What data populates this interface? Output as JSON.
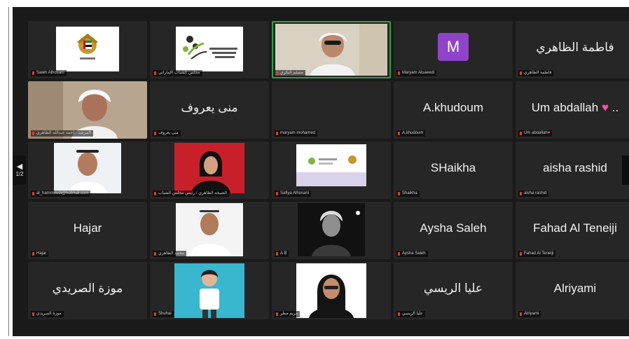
{
  "pagination": {
    "prev_icon": "◀",
    "prev_label": "1/2"
  },
  "tiles": [
    {
      "display": "",
      "tag": "Saleh Alhosani",
      "kind": "emblem"
    },
    {
      "display": "",
      "tag": "مجلس الشباب الإماراتي",
      "kind": "logo"
    },
    {
      "display": "",
      "tag": "مسلم البكري",
      "kind": "video",
      "active": true
    },
    {
      "display": "M",
      "tag": "Maryam Alsaeedi",
      "kind": "avatar"
    },
    {
      "display": "فاطمة الظاهري",
      "tag": "فاطمة الظاهري",
      "kind": "name"
    },
    {
      "display": "",
      "tag": "المرشد - أحمد عبدالله الظاهري",
      "kind": "video"
    },
    {
      "display": "منى يعروف",
      "tag": "منى يعروف",
      "kind": "name"
    },
    {
      "display": "",
      "tag": "maryam mohamed",
      "kind": "blank"
    },
    {
      "display": "A.khudoum",
      "tag": "A.khudoum",
      "kind": "name"
    },
    {
      "display": "Um abdallah",
      "tag": "Um abdallah",
      "kind": "name-heart"
    },
    {
      "display": "",
      "tag": "al_hammoudi@hotmail.com",
      "kind": "video"
    },
    {
      "display": "",
      "tag": "الشيخة الظاهري / رئيس مجلس الشباب",
      "kind": "video-red"
    },
    {
      "display": "",
      "tag": "Safiya Alhosani",
      "kind": "slide"
    },
    {
      "display": "SHaikha",
      "tag": "Shaikha",
      "kind": "name"
    },
    {
      "display": "aisha rashid",
      "tag": "aisha rashid",
      "kind": "name"
    },
    {
      "display": "Hajar",
      "tag": "Hajar",
      "kind": "name"
    },
    {
      "display": "",
      "tag": "محمد الظاهري",
      "kind": "video"
    },
    {
      "display": "",
      "tag": "A B",
      "kind": "video-dark"
    },
    {
      "display": "Aysha Saleh",
      "tag": "Aysha Saleh",
      "kind": "name"
    },
    {
      "display": "Fahad Al Teneiji",
      "tag": "Fahad Al Teneiji",
      "kind": "name"
    },
    {
      "display": "موزة الصريدي",
      "tag": "موزة الصريدي",
      "kind": "name"
    },
    {
      "display": "",
      "tag": "Shuhai",
      "kind": "video-blue"
    },
    {
      "display": "",
      "tag": "مريم مطر",
      "kind": "video-white"
    },
    {
      "display": "عليا الريسي",
      "tag": "عليا الريسي",
      "kind": "name"
    },
    {
      "display": "Alriyami",
      "tag": "Alriyami",
      "kind": "name"
    }
  ],
  "colors": {
    "background": "#1a1a1a",
    "tile": "#262626",
    "active_speaker": "#2ea043",
    "mic_icon": "#e23b3b",
    "avatar": "#8e44c8"
  }
}
